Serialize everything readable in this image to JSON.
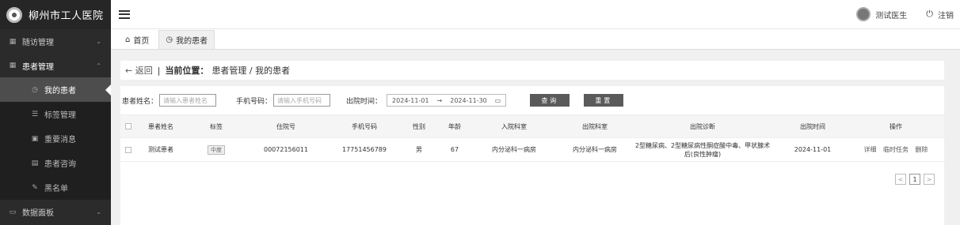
{
  "app": {
    "title": "柳州市工人医院"
  },
  "sidebar": {
    "items": [
      {
        "label": "随访管理",
        "icon": "grid-icon",
        "chevron": "⌄"
      },
      {
        "label": "患者管理",
        "icon": "grid-icon",
        "chevron": "⌃"
      },
      {
        "label": "数据面板",
        "icon": "monitor-icon",
        "chevron": "⌄"
      }
    ],
    "sub": [
      {
        "label": "我的患者",
        "icon": "clock-icon"
      },
      {
        "label": "标签管理",
        "icon": "list-icon"
      },
      {
        "label": "重要消息",
        "icon": "message-icon"
      },
      {
        "label": "患者咨询",
        "icon": "phone-icon"
      },
      {
        "label": "黑名单",
        "icon": "edit-icon"
      }
    ]
  },
  "header": {
    "user": "测试医生",
    "logout": "注销"
  },
  "tabs": [
    {
      "label": "首页"
    },
    {
      "label": "我的患者"
    }
  ],
  "breadcrumb": {
    "back": "← 返回",
    "current_label": "当前位置：",
    "path": "患者管理 / 我的患者"
  },
  "filters": {
    "name_label": "患者姓名：",
    "name_placeholder": "请输入患者姓名",
    "phone_label": "手机号码：",
    "phone_placeholder": "请输入手机号码",
    "date_label": "出院时间：",
    "date_start": "2024-11-01",
    "date_sep": "→",
    "date_end": "2024-11-30",
    "query_button": "查询",
    "reset_button": "重置"
  },
  "table": {
    "headers": [
      "患者姓名",
      "标签",
      "住院号",
      "手机号码",
      "性别",
      "年龄",
      "入院科室",
      "出院科室",
      "出院诊断",
      "出院时间",
      "操作"
    ],
    "rows": [
      {
        "name": "测试患者",
        "tag": "中度",
        "inpatient_no": "00072156011",
        "phone": "17751456789",
        "gender": "男",
        "age": "67",
        "admit_dept": "内分泌科一病房",
        "discharge_dept": "内分泌科一病房",
        "diagnosis": "2型糖尿病、2型糖尿病性酮症酸中毒、甲状腺术后(良性肿瘤)",
        "discharge_date": "2024-11-01",
        "ops": [
          "详细",
          "临时任务",
          "删除"
        ]
      }
    ]
  },
  "pager": {
    "prev": "<",
    "page": "1",
    "next": ">"
  }
}
